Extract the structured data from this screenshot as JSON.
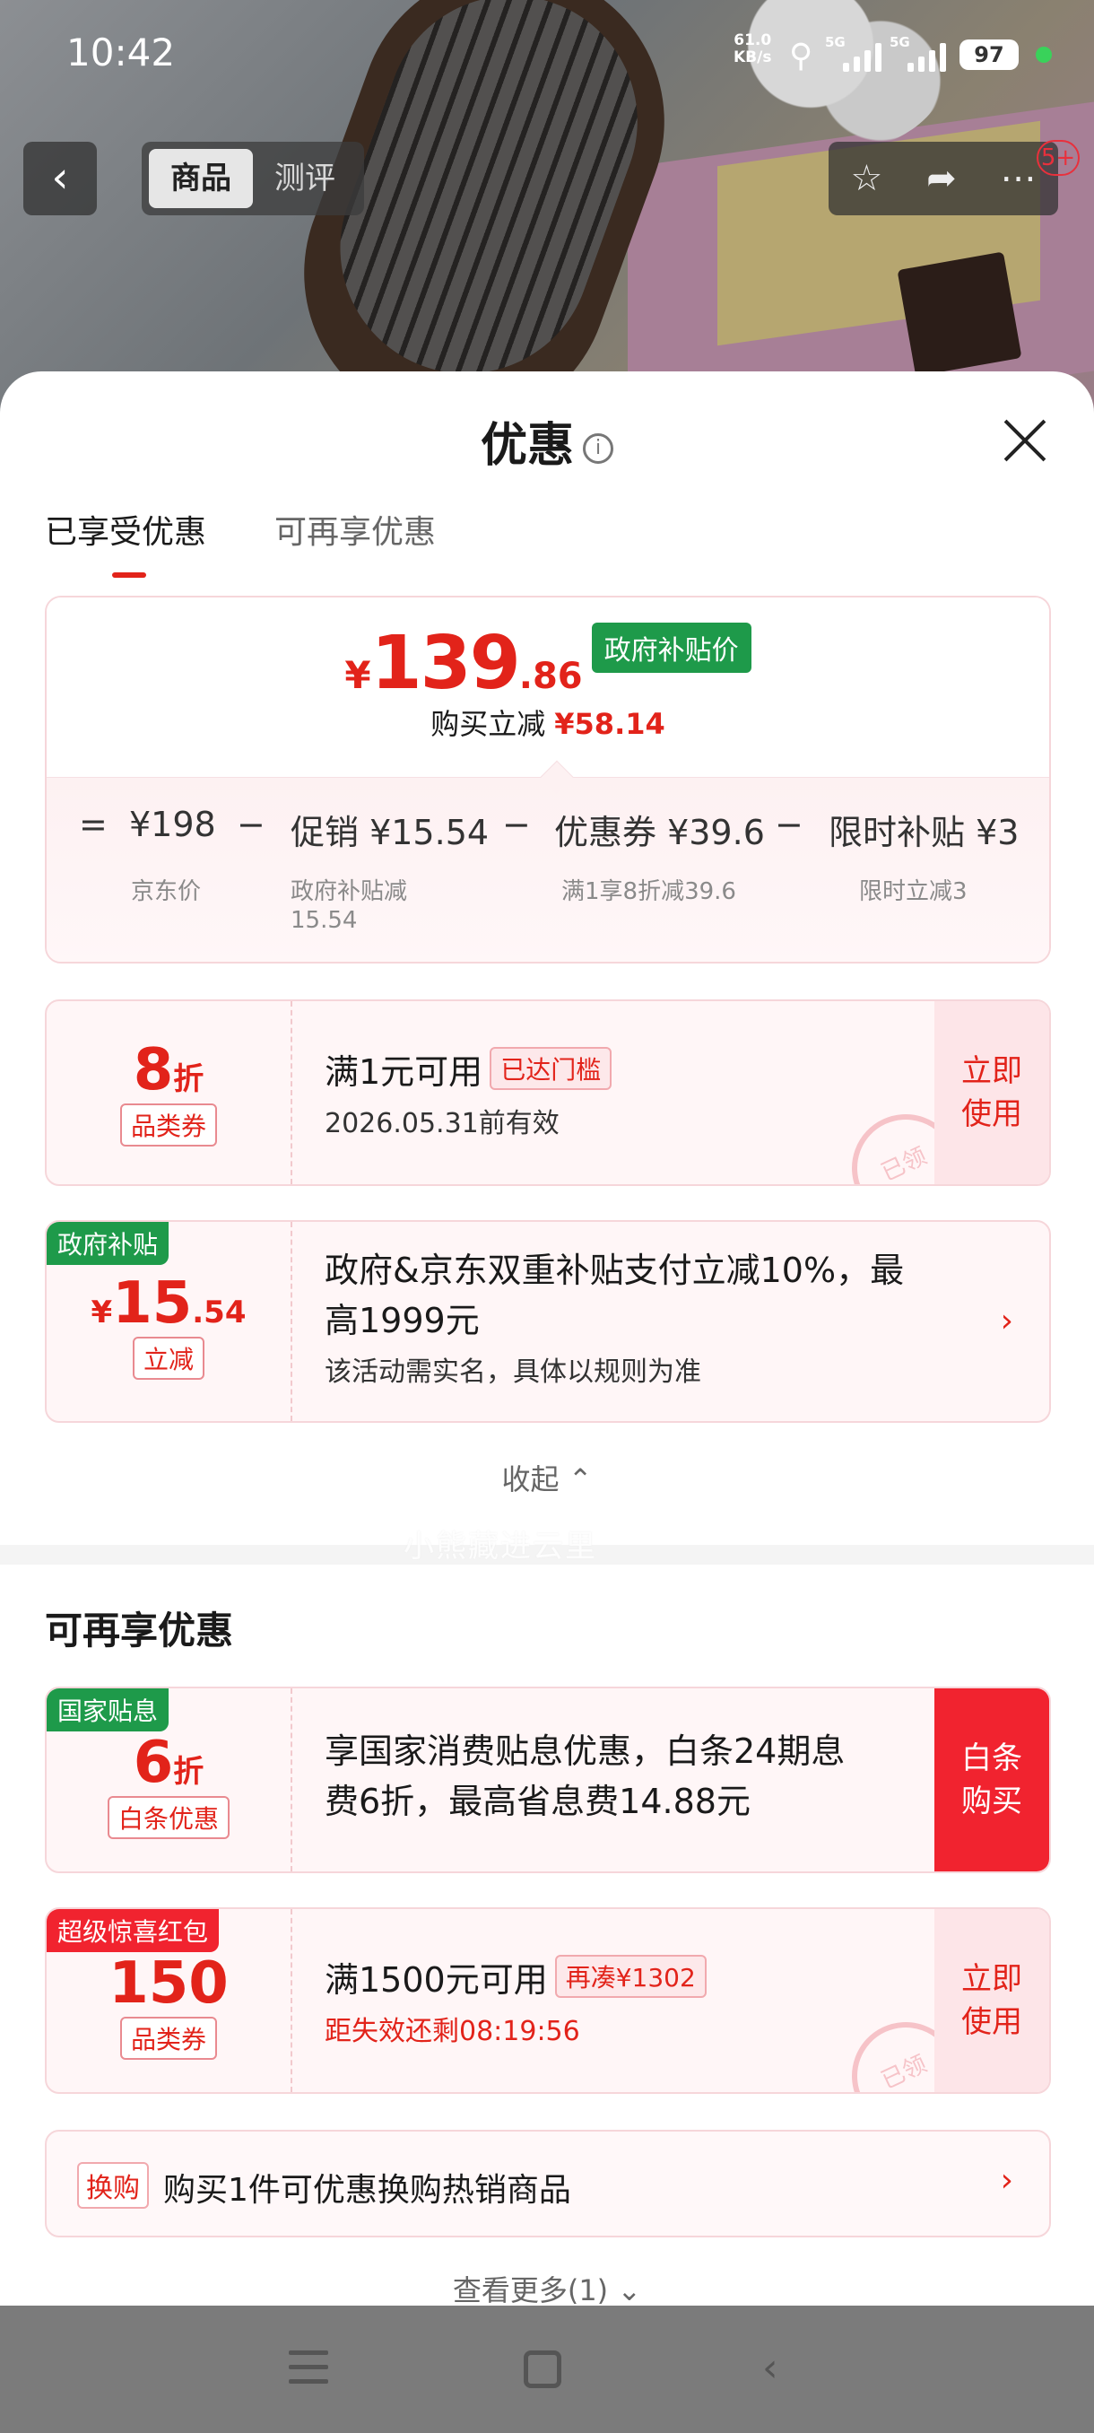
{
  "status_bar": {
    "time": "10:42",
    "net_speed": "61.0",
    "net_unit": "KB/s",
    "sig1": "5G",
    "sig2": "5G",
    "battery": "97"
  },
  "nav": {
    "tab_product": "商品",
    "tab_review": "测评",
    "badge": "5+"
  },
  "sheet": {
    "title": "优惠",
    "tabs": [
      "已享受优惠",
      "可再享优惠"
    ],
    "summary": {
      "yen": "¥",
      "price_int": "139",
      "price_dec": ".86",
      "gov_tag": "政府补贴价",
      "reduce_label": "购买立减",
      "reduce_amount": "¥58.14",
      "eq": "=",
      "minus": "−",
      "items": [
        {
          "label": "¥198",
          "sub": "京东价"
        },
        {
          "label": "促销 ¥15.54",
          "sub": "政府补贴减",
          "sub2": "15.54"
        },
        {
          "label": "优惠券 ¥39.6",
          "sub": "满1享8折减39.6"
        },
        {
          "label": "限时补贴 ¥3",
          "sub": "限时立减3"
        }
      ]
    },
    "coupon1": {
      "value": "8",
      "unit": "折",
      "tag": "品类券",
      "title": "满1元可用",
      "pill": "已达门槛",
      "sub": "2026.05.31前有效",
      "action": "立即使用",
      "stamp": "已领"
    },
    "coupon2": {
      "corner": "政府补贴",
      "yen": "¥",
      "value": "15",
      "dec": ".54",
      "tag": "立减",
      "title_line1": "政府&京东双重补贴支付立减10%，最",
      "title_line2": "高1999元",
      "sub": "该活动需实名，具体以规则为准"
    },
    "collapse": "收起",
    "section2_title": "可再享优惠",
    "coupon3": {
      "corner": "国家贴息",
      "value": "6",
      "unit": "折",
      "tag": "白条优惠",
      "title_line1": "享国家消费贴息优惠，白条24期息",
      "title_line2": "费6折，最高省息费14.88元",
      "action": "白条购买"
    },
    "coupon4": {
      "corner": "超级惊喜红包",
      "value": "150",
      "tag": "品类券",
      "title": "满1500元可用",
      "pill": "再凑¥1302",
      "sub": "距失效还剩08:19:56",
      "action": "立即使用",
      "stamp": "已领"
    },
    "swap": {
      "tag": "换购",
      "text": "购买1件可优惠换购热销商品"
    },
    "see_more": "查看更多(1)",
    "watermark": "小熊藏进云里"
  },
  "colors": {
    "accent_red": "#e2231a",
    "gov_green": "#1e9a4a"
  }
}
